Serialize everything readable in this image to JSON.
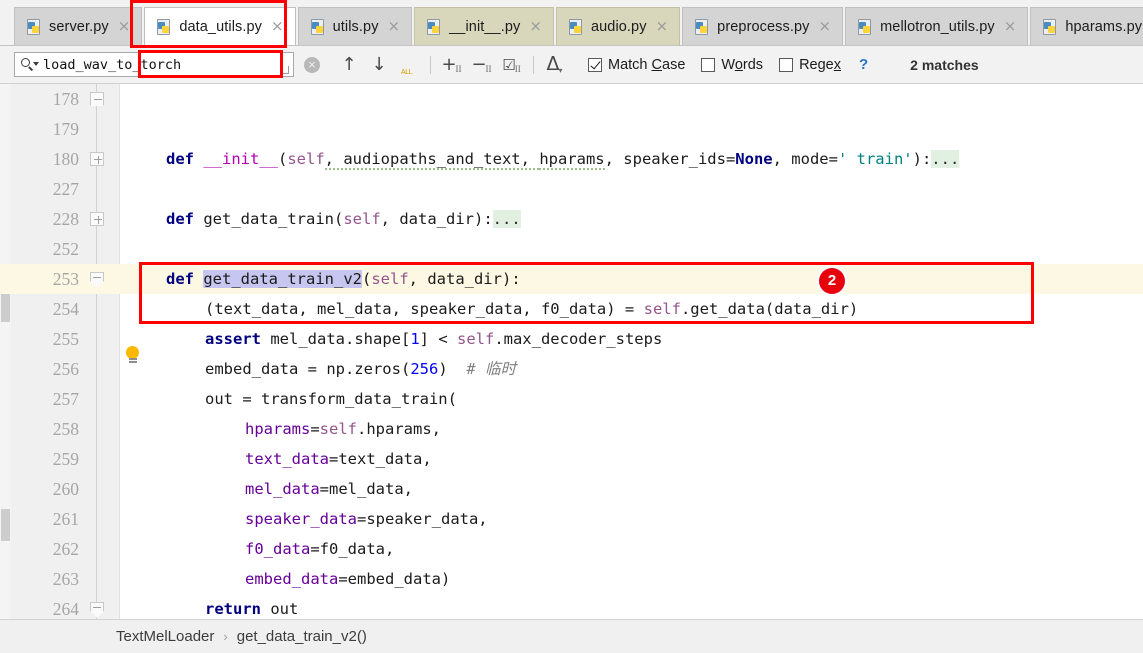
{
  "tabs": [
    {
      "label": "server.py",
      "icon": "python-file-icon",
      "state": "inactive",
      "close": "×"
    },
    {
      "label": "data_utils.py",
      "icon": "python-file-icon",
      "state": "active",
      "close": "×"
    },
    {
      "label": "utils.py",
      "icon": "python-file-icon",
      "state": "inactive",
      "close": "×"
    },
    {
      "label": "__init__.py",
      "icon": "python-file-icon",
      "state": "modified",
      "close": "×"
    },
    {
      "label": "audio.py",
      "icon": "python-file-icon",
      "state": "modified",
      "close": "×"
    },
    {
      "label": "preprocess.py",
      "icon": "python-file-icon",
      "state": "inactive",
      "close": "×"
    },
    {
      "label": "mellotron_utils.py",
      "icon": "python-file-icon",
      "state": "inactive",
      "close": "×"
    },
    {
      "label": "hparams.py",
      "icon": "python-file-icon",
      "state": "inactive",
      "close": "×"
    }
  ],
  "find": {
    "search_value": "load_wav_to_torch",
    "search_placeholder": "Search",
    "clear_label": "×",
    "prev_label": "↑",
    "next_label": "↓",
    "find_all_label": "ALL",
    "add_occurrence_label": "+",
    "remove_occurrence_label": "−",
    "select_all_occurrences_label": "☑",
    "occurrence_sub": "II",
    "filter_label": "ᐃ",
    "match_case": {
      "label_pre": "Match ",
      "label_key": "C",
      "label_post": "ase",
      "checked": true
    },
    "words": {
      "label_pre": "W",
      "label_key": "o",
      "label_post": "rds",
      "checked": false
    },
    "regex": {
      "label_pre": "Rege",
      "label_key": "x",
      "label_post": "",
      "checked": false
    },
    "help_label": "?",
    "matches_label": "2 matches"
  },
  "editor": {
    "lines": [
      {
        "no": "178",
        "fold": "end",
        "indent": 0,
        "highlight": false
      },
      {
        "no": "179",
        "fold": "",
        "indent": 0,
        "highlight": false
      },
      {
        "no": "180",
        "fold": "plus",
        "indent": 0,
        "highlight": false
      },
      {
        "no": "227",
        "fold": "",
        "indent": 0,
        "highlight": false
      },
      {
        "no": "228",
        "fold": "plus",
        "indent": 0,
        "highlight": false
      },
      {
        "no": "252",
        "fold": "",
        "indent": 0,
        "highlight": false
      },
      {
        "no": "253",
        "fold": "open",
        "indent": 0,
        "highlight": true
      },
      {
        "no": "254",
        "fold": "",
        "indent": 0,
        "highlight": false
      },
      {
        "no": "255",
        "fold": "",
        "indent": 0,
        "highlight": false
      },
      {
        "no": "256",
        "fold": "",
        "indent": 0,
        "highlight": false
      },
      {
        "no": "257",
        "fold": "",
        "indent": 0,
        "highlight": false
      },
      {
        "no": "258",
        "fold": "",
        "indent": 0,
        "highlight": false
      },
      {
        "no": "259",
        "fold": "",
        "indent": 0,
        "highlight": false
      },
      {
        "no": "260",
        "fold": "",
        "indent": 0,
        "highlight": false
      },
      {
        "no": "261",
        "fold": "",
        "indent": 0,
        "highlight": false
      },
      {
        "no": "262",
        "fold": "",
        "indent": 0,
        "highlight": false
      },
      {
        "no": "263",
        "fold": "",
        "indent": 0,
        "highlight": false
      },
      {
        "no": "264",
        "fold": "end",
        "indent": 0,
        "highlight": false
      }
    ],
    "code": {
      "l178_docstring": "\"\"\"",
      "l180": {
        "kw": "def",
        "name": "__init__",
        "args_open": "(",
        "self": "self",
        "a1": ", audiopaths_and_text, ",
        "a2": "hparams",
        "a3": ", speaker_ids=",
        "none": "None",
        "a4": ", mode=",
        "str": "' train'",
        "close": "):",
        "ellipsis": "..."
      },
      "l228": {
        "kw": "def",
        "name": "get_data_train",
        "open": "(",
        "self": "self",
        "args": ", data_dir",
        "close": "):",
        "ellipsis": "..."
      },
      "l253": {
        "kw": "def",
        "name": "get_data_train_v2",
        "open": "(",
        "self": "self",
        "args": ", data_dir",
        "close": "):"
      },
      "l254": {
        "tuple": "(text_data, mel_data, speaker_data, f0_data) = ",
        "self": "self",
        "call": ".get_data(data_dir)"
      },
      "l255": {
        "kw": "assert",
        "expr": " mel_data.shape[",
        "num": "1",
        "expr2": "] < ",
        "self": "self",
        "attr": ".max_decoder_steps"
      },
      "l256": {
        "expr": "embed_data = np.zeros(",
        "num": "256",
        "expr2": ")",
        "comment": "# 临时"
      },
      "l257": {
        "expr": "out = transform_data_train("
      },
      "l258": {
        "kwarg": "hparams",
        "eq": "=",
        "self": "self",
        "rest": ".hparams,"
      },
      "l259": {
        "kwarg": "text_data",
        "eq": "=",
        "rest": "text_data,"
      },
      "l260": {
        "kwarg": "mel_data",
        "eq": "=",
        "rest": "mel_data,"
      },
      "l261": {
        "kwarg": "speaker_data",
        "eq": "=",
        "rest": "speaker_data,"
      },
      "l262": {
        "kwarg": "f0_data",
        "eq": "=",
        "rest": "f0_data,"
      },
      "l263": {
        "kwarg": "embed_data",
        "eq": "=",
        "rest": "embed_data)"
      },
      "l264": {
        "kw": "return",
        "rest": " out"
      }
    }
  },
  "annotations": {
    "badge_number": "2",
    "highlight_color": "#ff0000",
    "badge_color": "#e8000d"
  },
  "breadcrumb": {
    "class_name": "TextMelLoader",
    "separator": "›",
    "method_name": "get_data_train_v2()"
  }
}
